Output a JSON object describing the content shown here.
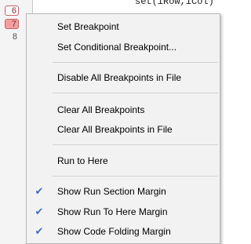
{
  "editor": {
    "line_numbers": [
      {
        "label": "6",
        "breakpoint": true,
        "active": false
      },
      {
        "label": "7",
        "breakpoint": true,
        "active": true
      },
      {
        "label": "8",
        "breakpoint": false,
        "active": false
      }
    ],
    "code_fragment": "set(iRow,iCol)"
  },
  "menu": {
    "items": [
      {
        "label": "Set Breakpoint"
      },
      {
        "label": "Set Conditional Breakpoint..."
      },
      {
        "label": "Disable All Breakpoints in File"
      },
      {
        "label": "Clear All Breakpoints"
      },
      {
        "label": "Clear All Breakpoints in File"
      },
      {
        "label": "Run to Here"
      },
      {
        "label": "Show Run Section Margin",
        "checked": true
      },
      {
        "label": "Show Run To Here Margin",
        "checked": true
      },
      {
        "label": "Show Code Folding Margin",
        "checked": true
      }
    ],
    "check_glyph": "✔",
    "check_color": "#3a6fc4"
  }
}
